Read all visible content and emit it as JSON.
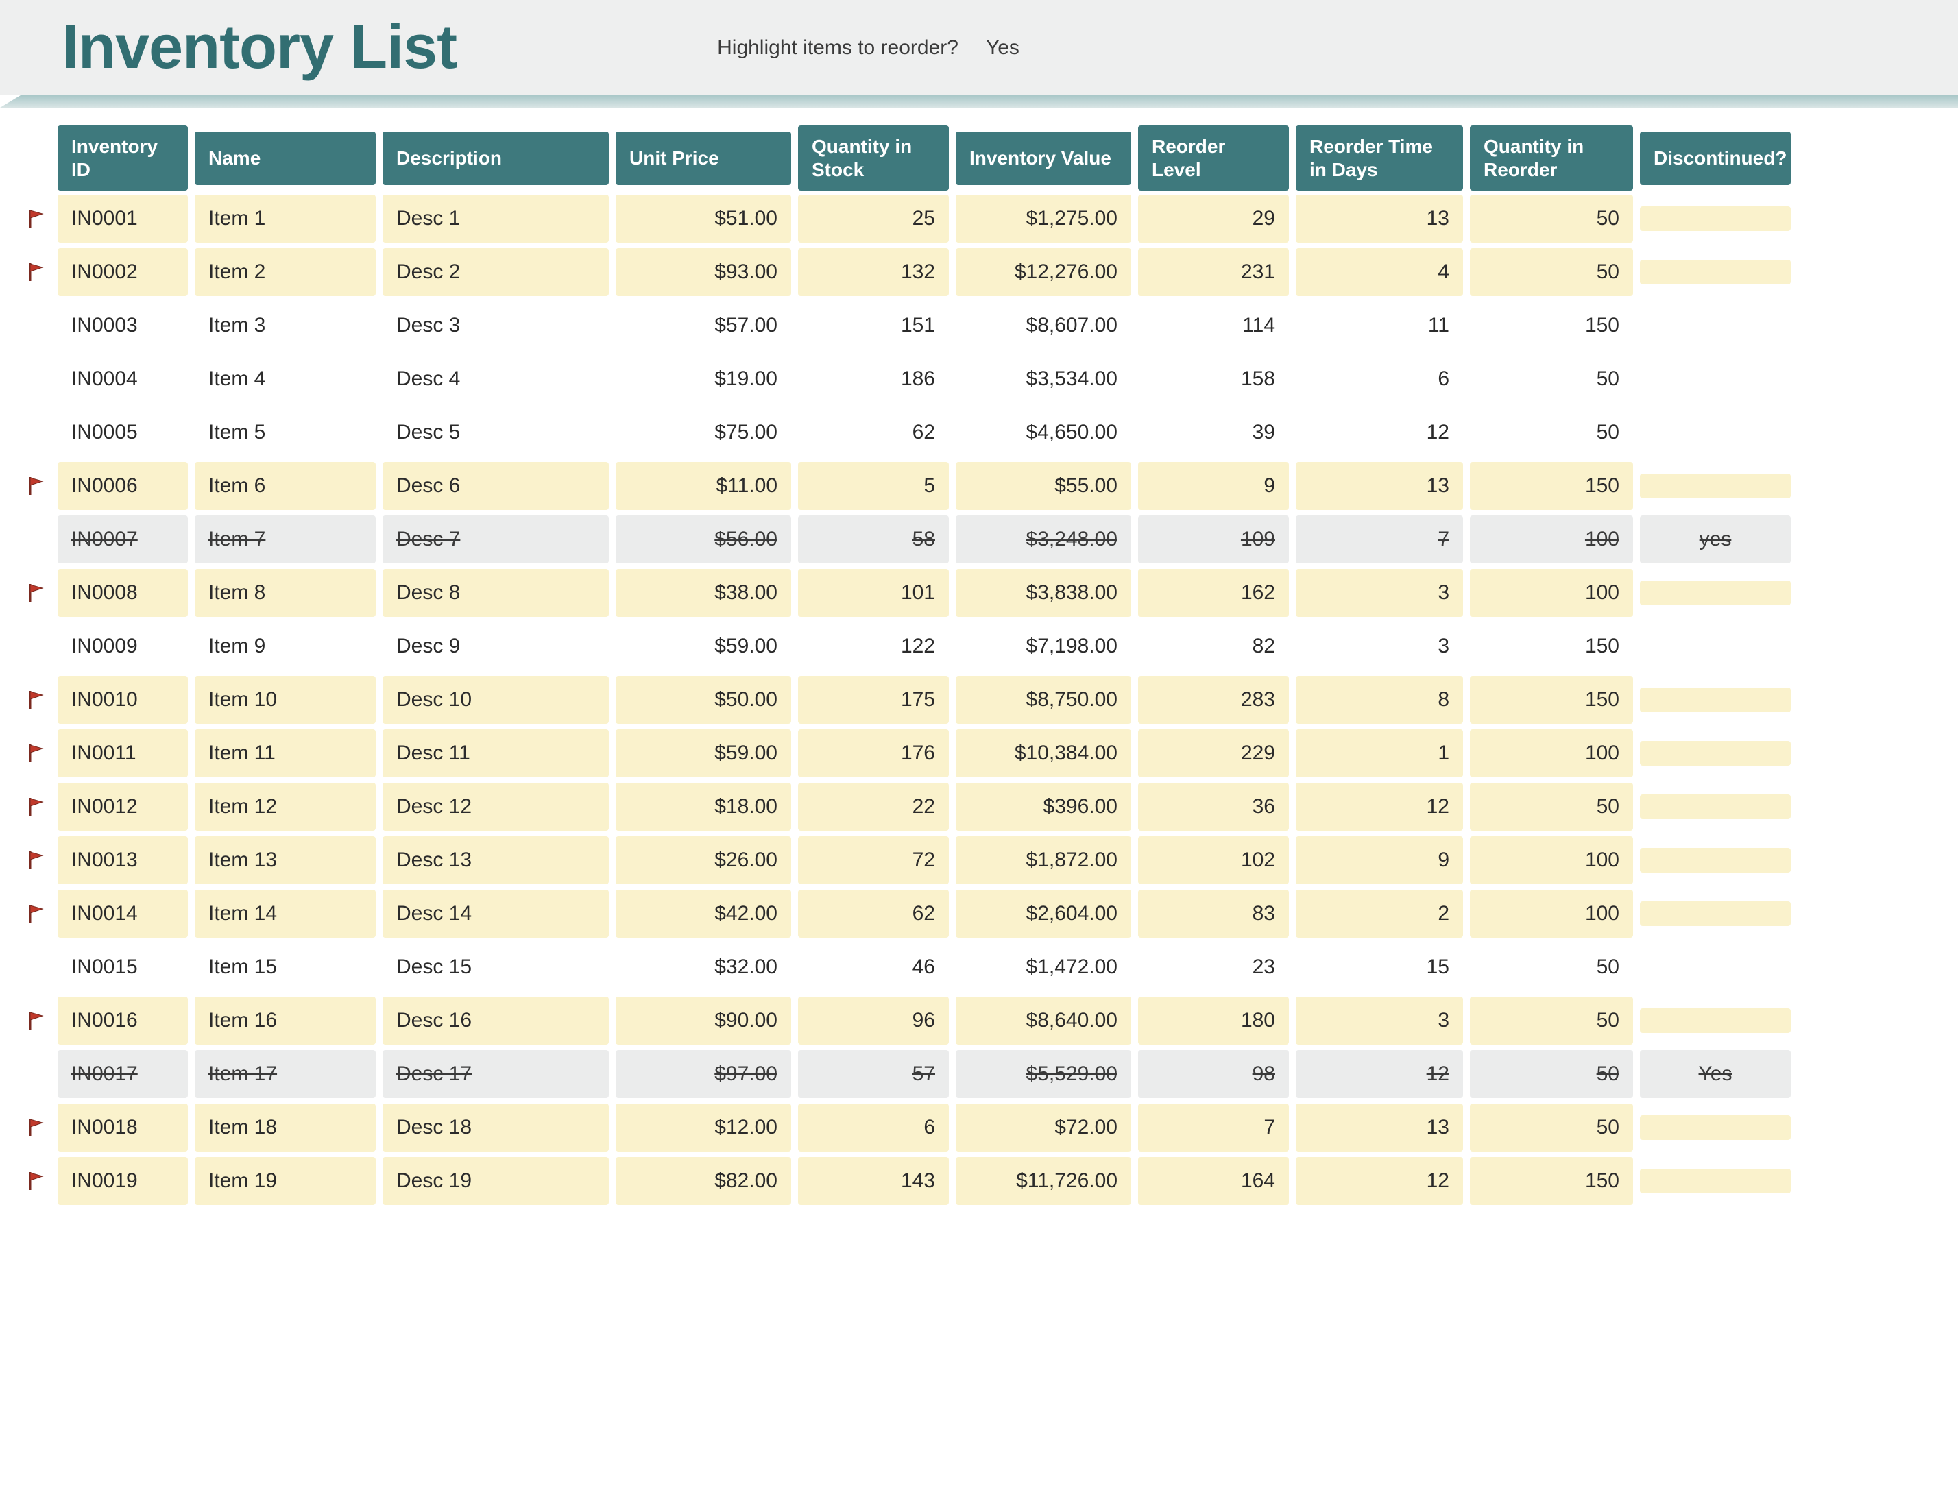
{
  "header": {
    "title": "Inventory List",
    "highlight_label": "Highlight items to reorder?",
    "highlight_value": "Yes"
  },
  "columns": {
    "id": "Inventory ID",
    "name": "Name",
    "desc": "Description",
    "price": "Unit Price",
    "qty": "Quantity in Stock",
    "value": "Inventory Value",
    "reorder_level": "Reorder Level",
    "reorder_days": "Reorder Time in Days",
    "qty_reorder": "Quantity in Reorder",
    "discontinued": "Discontinued?"
  },
  "rows": [
    {
      "flag": true,
      "highlight": true,
      "discontinued": false,
      "id": "IN0001",
      "name": "Item 1",
      "desc": "Desc 1",
      "price": "$51.00",
      "qty": "25",
      "value": "$1,275.00",
      "reorder_level": "29",
      "reorder_days": "13",
      "qty_reorder": "50",
      "disc_text": ""
    },
    {
      "flag": true,
      "highlight": true,
      "discontinued": false,
      "id": "IN0002",
      "name": "Item 2",
      "desc": "Desc 2",
      "price": "$93.00",
      "qty": "132",
      "value": "$12,276.00",
      "reorder_level": "231",
      "reorder_days": "4",
      "qty_reorder": "50",
      "disc_text": ""
    },
    {
      "flag": false,
      "highlight": false,
      "discontinued": false,
      "id": "IN0003",
      "name": "Item 3",
      "desc": "Desc 3",
      "price": "$57.00",
      "qty": "151",
      "value": "$8,607.00",
      "reorder_level": "114",
      "reorder_days": "11",
      "qty_reorder": "150",
      "disc_text": ""
    },
    {
      "flag": false,
      "highlight": false,
      "discontinued": false,
      "id": "IN0004",
      "name": "Item 4",
      "desc": "Desc 4",
      "price": "$19.00",
      "qty": "186",
      "value": "$3,534.00",
      "reorder_level": "158",
      "reorder_days": "6",
      "qty_reorder": "50",
      "disc_text": ""
    },
    {
      "flag": false,
      "highlight": false,
      "discontinued": false,
      "id": "IN0005",
      "name": "Item 5",
      "desc": "Desc 5",
      "price": "$75.00",
      "qty": "62",
      "value": "$4,650.00",
      "reorder_level": "39",
      "reorder_days": "12",
      "qty_reorder": "50",
      "disc_text": ""
    },
    {
      "flag": true,
      "highlight": true,
      "discontinued": false,
      "id": "IN0006",
      "name": "Item 6",
      "desc": "Desc 6",
      "price": "$11.00",
      "qty": "5",
      "value": "$55.00",
      "reorder_level": "9",
      "reorder_days": "13",
      "qty_reorder": "150",
      "disc_text": ""
    },
    {
      "flag": false,
      "highlight": false,
      "discontinued": true,
      "id": "IN0007",
      "name": "Item 7",
      "desc": "Desc 7",
      "price": "$56.00",
      "qty": "58",
      "value": "$3,248.00",
      "reorder_level": "109",
      "reorder_days": "7",
      "qty_reorder": "100",
      "disc_text": "yes"
    },
    {
      "flag": true,
      "highlight": true,
      "discontinued": false,
      "id": "IN0008",
      "name": "Item 8",
      "desc": "Desc 8",
      "price": "$38.00",
      "qty": "101",
      "value": "$3,838.00",
      "reorder_level": "162",
      "reorder_days": "3",
      "qty_reorder": "100",
      "disc_text": ""
    },
    {
      "flag": false,
      "highlight": false,
      "discontinued": false,
      "id": "IN0009",
      "name": "Item 9",
      "desc": "Desc 9",
      "price": "$59.00",
      "qty": "122",
      "value": "$7,198.00",
      "reorder_level": "82",
      "reorder_days": "3",
      "qty_reorder": "150",
      "disc_text": ""
    },
    {
      "flag": true,
      "highlight": true,
      "discontinued": false,
      "id": "IN0010",
      "name": "Item 10",
      "desc": "Desc 10",
      "price": "$50.00",
      "qty": "175",
      "value": "$8,750.00",
      "reorder_level": "283",
      "reorder_days": "8",
      "qty_reorder": "150",
      "disc_text": ""
    },
    {
      "flag": true,
      "highlight": true,
      "discontinued": false,
      "id": "IN0011",
      "name": "Item 11",
      "desc": "Desc 11",
      "price": "$59.00",
      "qty": "176",
      "value": "$10,384.00",
      "reorder_level": "229",
      "reorder_days": "1",
      "qty_reorder": "100",
      "disc_text": ""
    },
    {
      "flag": true,
      "highlight": true,
      "discontinued": false,
      "id": "IN0012",
      "name": "Item 12",
      "desc": "Desc 12",
      "price": "$18.00",
      "qty": "22",
      "value": "$396.00",
      "reorder_level": "36",
      "reorder_days": "12",
      "qty_reorder": "50",
      "disc_text": ""
    },
    {
      "flag": true,
      "highlight": true,
      "discontinued": false,
      "id": "IN0013",
      "name": "Item 13",
      "desc": "Desc 13",
      "price": "$26.00",
      "qty": "72",
      "value": "$1,872.00",
      "reorder_level": "102",
      "reorder_days": "9",
      "qty_reorder": "100",
      "disc_text": ""
    },
    {
      "flag": true,
      "highlight": true,
      "discontinued": false,
      "id": "IN0014",
      "name": "Item 14",
      "desc": "Desc 14",
      "price": "$42.00",
      "qty": "62",
      "value": "$2,604.00",
      "reorder_level": "83",
      "reorder_days": "2",
      "qty_reorder": "100",
      "disc_text": ""
    },
    {
      "flag": false,
      "highlight": false,
      "discontinued": false,
      "id": "IN0015",
      "name": "Item 15",
      "desc": "Desc 15",
      "price": "$32.00",
      "qty": "46",
      "value": "$1,472.00",
      "reorder_level": "23",
      "reorder_days": "15",
      "qty_reorder": "50",
      "disc_text": ""
    },
    {
      "flag": true,
      "highlight": true,
      "discontinued": false,
      "id": "IN0016",
      "name": "Item 16",
      "desc": "Desc 16",
      "price": "$90.00",
      "qty": "96",
      "value": "$8,640.00",
      "reorder_level": "180",
      "reorder_days": "3",
      "qty_reorder": "50",
      "disc_text": ""
    },
    {
      "flag": false,
      "highlight": false,
      "discontinued": true,
      "id": "IN0017",
      "name": "Item 17",
      "desc": "Desc 17",
      "price": "$97.00",
      "qty": "57",
      "value": "$5,529.00",
      "reorder_level": "98",
      "reorder_days": "12",
      "qty_reorder": "50",
      "disc_text": "Yes"
    },
    {
      "flag": true,
      "highlight": true,
      "discontinued": false,
      "id": "IN0018",
      "name": "Item 18",
      "desc": "Desc 18",
      "price": "$12.00",
      "qty": "6",
      "value": "$72.00",
      "reorder_level": "7",
      "reorder_days": "13",
      "qty_reorder": "50",
      "disc_text": ""
    },
    {
      "flag": true,
      "highlight": true,
      "discontinued": false,
      "id": "IN0019",
      "name": "Item 19",
      "desc": "Desc 19",
      "price": "$82.00",
      "qty": "143",
      "value": "$11,726.00",
      "reorder_level": "164",
      "reorder_days": "12",
      "qty_reorder": "150",
      "disc_text": ""
    }
  ]
}
